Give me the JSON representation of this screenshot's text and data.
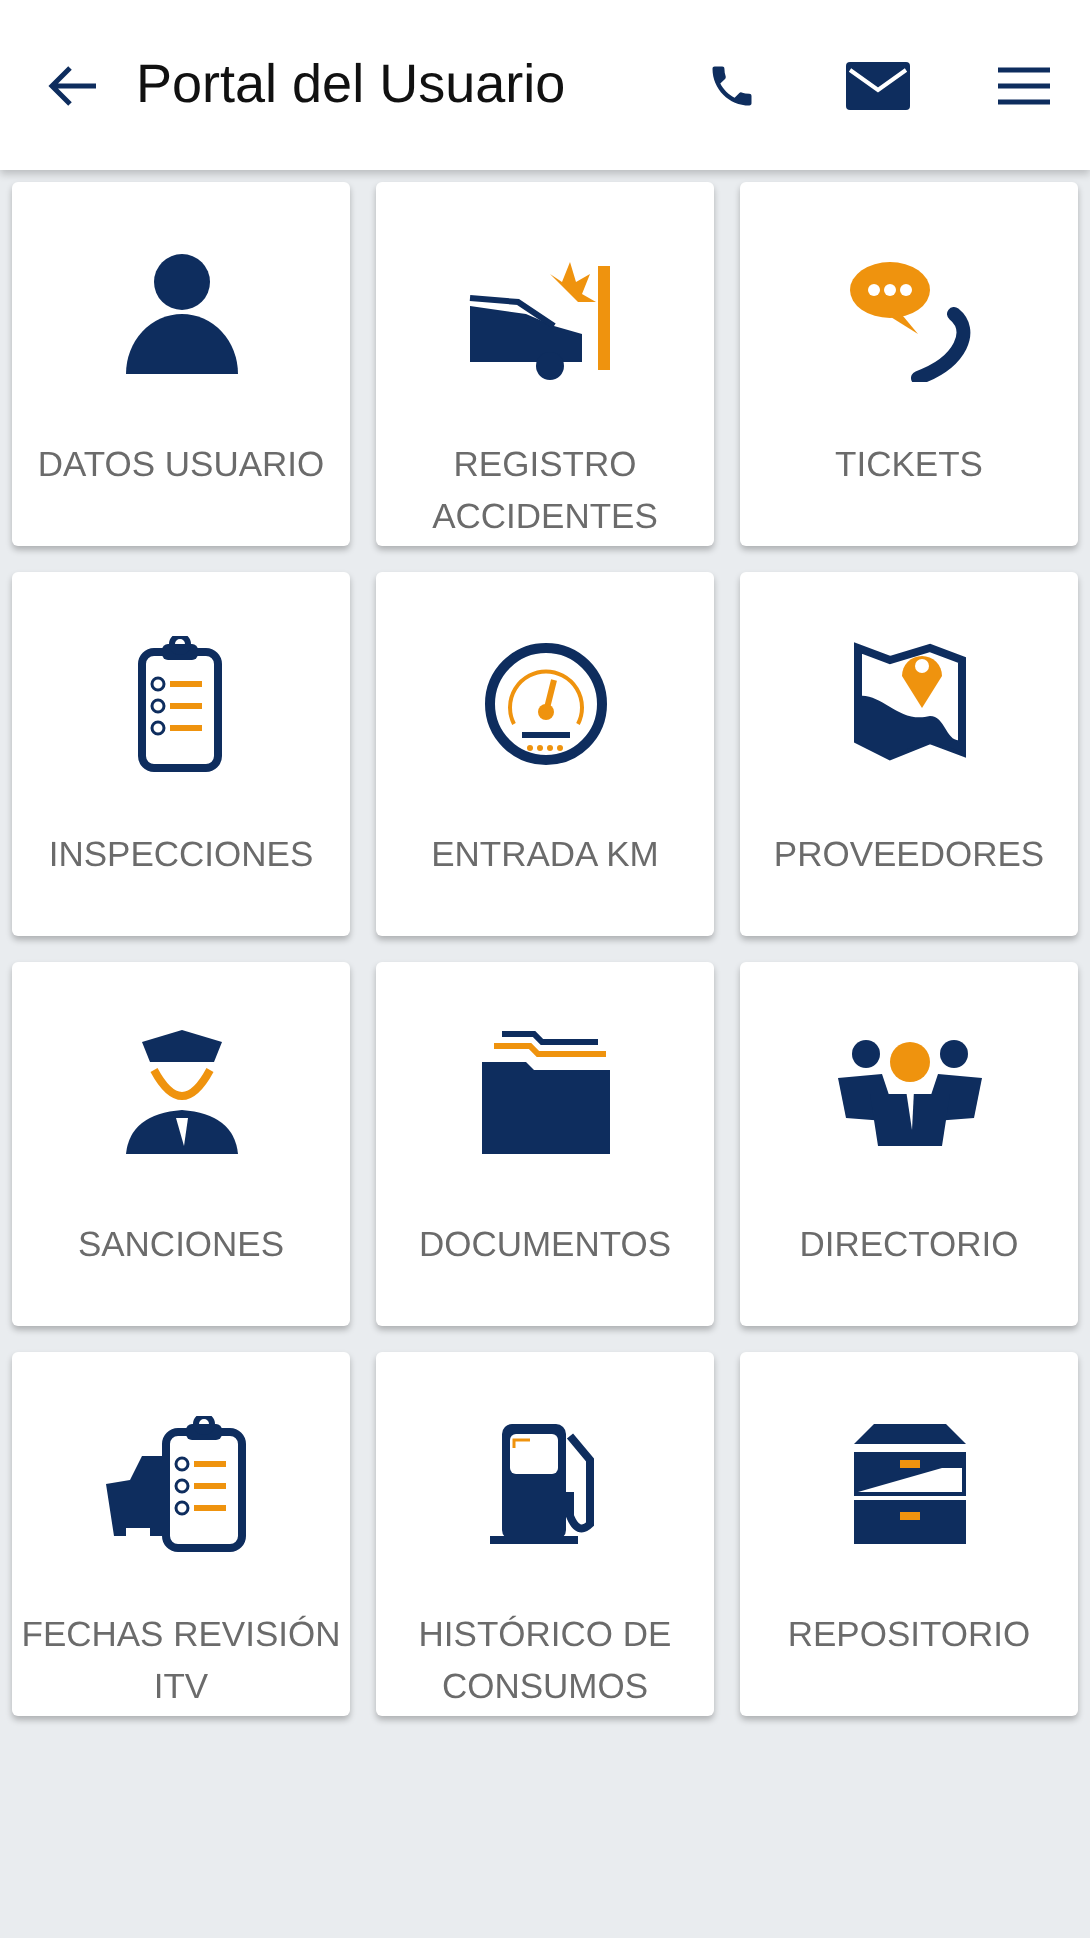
{
  "header": {
    "title": "Portal del Usuario"
  },
  "tiles": [
    {
      "kind": "user",
      "label": "DATOS USUARIO"
    },
    {
      "kind": "crash",
      "label": "REGISTRO ACCIDENTES"
    },
    {
      "kind": "chat-phone",
      "label": "TICKETS"
    },
    {
      "kind": "clipboard",
      "label": "INSPECCIONES"
    },
    {
      "kind": "gauge",
      "label": "ENTRADA KM"
    },
    {
      "kind": "map",
      "label": "PROVEEDORES"
    },
    {
      "kind": "officer",
      "label": "SANCIONES"
    },
    {
      "kind": "folder",
      "label": "DOCUMENTOS"
    },
    {
      "kind": "people",
      "label": "DIRECTORIO"
    },
    {
      "kind": "car-clipboard",
      "label": "FECHAS REVISIÓN ITV"
    },
    {
      "kind": "fuel",
      "label": "HISTÓRICO DE CONSUMOS"
    },
    {
      "kind": "cabinet",
      "label": "REPOSITORIO"
    }
  ]
}
